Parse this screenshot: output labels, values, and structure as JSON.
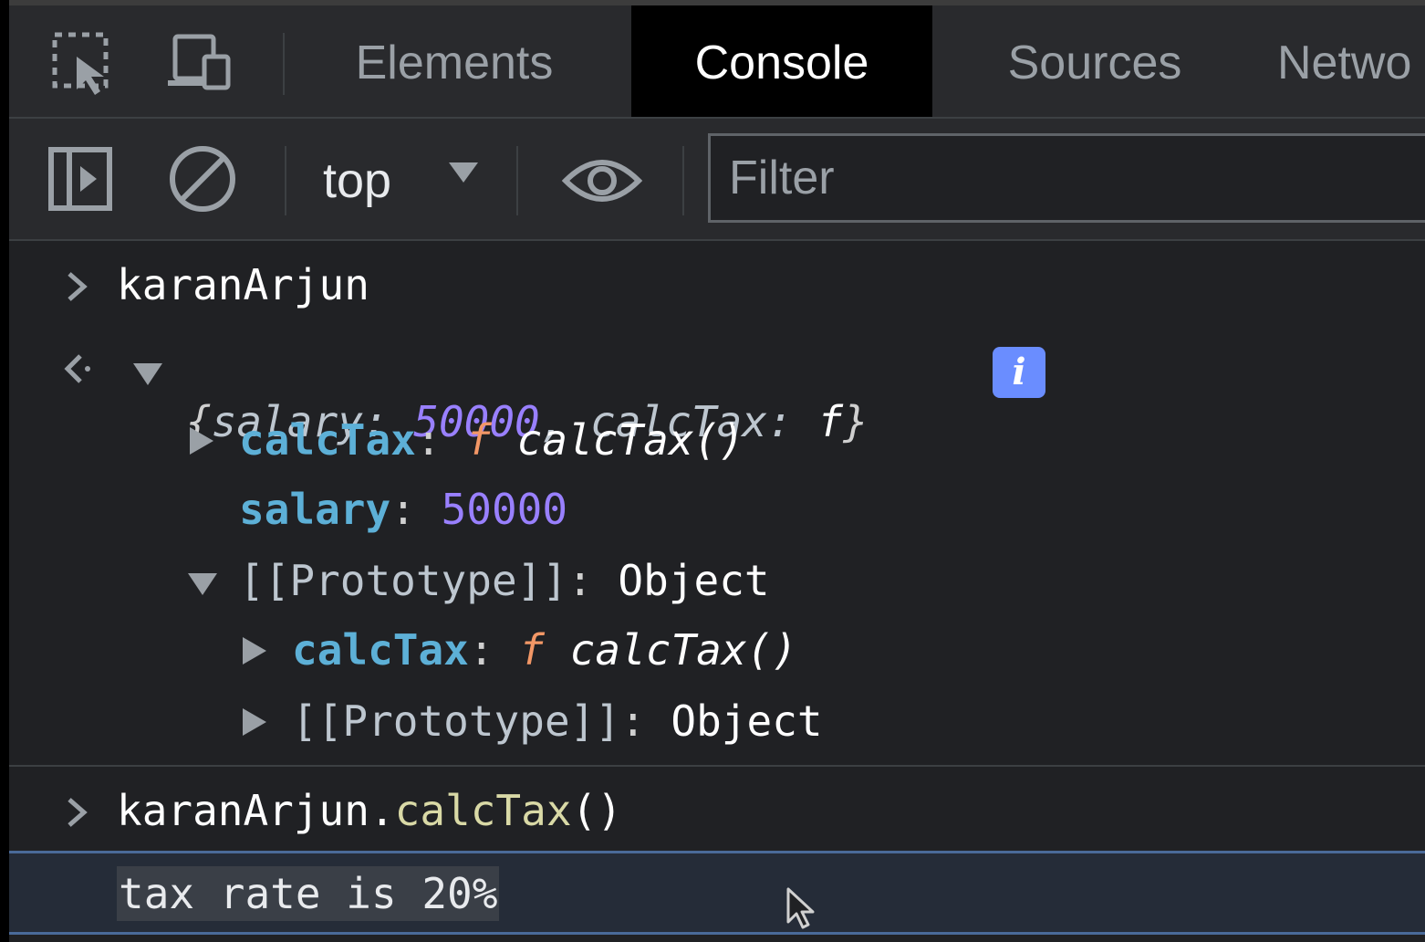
{
  "tabs": [
    {
      "label": "Elements",
      "active": false
    },
    {
      "label": "Console",
      "active": true
    },
    {
      "label": "Sources",
      "active": false
    },
    {
      "label": "Netwo",
      "active": false
    }
  ],
  "toolbar": {
    "context": "top",
    "filter_placeholder": "Filter"
  },
  "console": {
    "input1": "karanArjun",
    "result_preview": {
      "open": "{",
      "key1": "salary",
      "colon1": ": ",
      "val1": "50000",
      "comma": ", ",
      "key2": "calcTax",
      "colon2": ": ",
      "val2": "f",
      "close": "}"
    },
    "info_badge": "i",
    "prop_calcTax": {
      "key": "calcTax",
      "colon": ": ",
      "f": "f",
      "name": " calcTax()"
    },
    "prop_salary": {
      "key": "salary",
      "colon": ": ",
      "value": "50000"
    },
    "proto1": {
      "key": "[[Prototype]]",
      "colon": ": ",
      "value": "Object"
    },
    "proto_calcTax": {
      "key": "calcTax",
      "colon": ": ",
      "f": "f",
      "name": " calcTax()"
    },
    "proto2": {
      "key": "[[Prototype]]",
      "colon": ": ",
      "value": "Object"
    },
    "input2": {
      "object": "karanArjun",
      "dot": ".",
      "method": "calcTax",
      "parens": "()"
    },
    "log_output": "tax rate is 20%"
  },
  "colors": {
    "number": "#9980ff",
    "property": "#5db0d7",
    "function_f": "#f29766",
    "method": "#d9d9a6",
    "info_badge": "#6a8dff"
  },
  "icons": [
    "inspect-element-icon",
    "device-toggle-icon",
    "sidebar-toggle-icon",
    "clear-console-icon",
    "dropdown-arrow-icon",
    "live-expression-eye-icon",
    "mouse-cursor-icon"
  ]
}
